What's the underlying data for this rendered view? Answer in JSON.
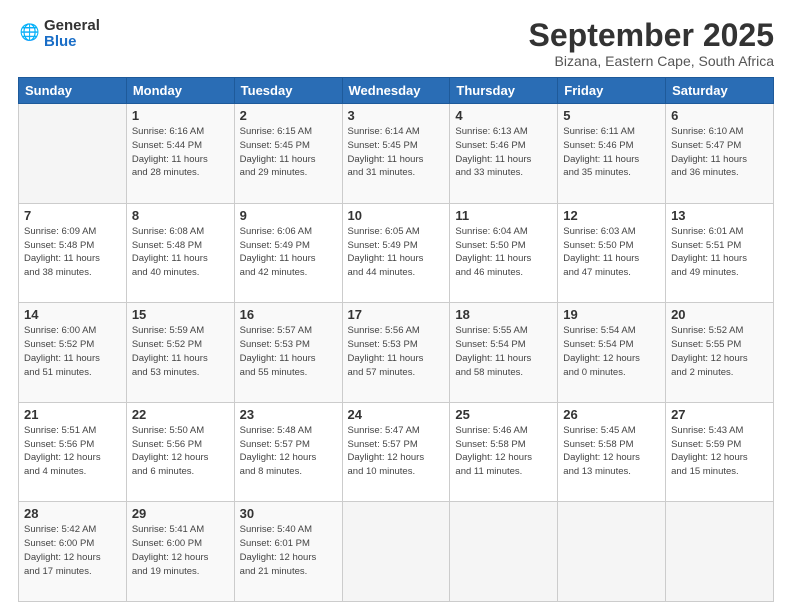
{
  "header": {
    "logo_general": "General",
    "logo_blue": "Blue",
    "title": "September 2025",
    "subtitle": "Bizana, Eastern Cape, South Africa"
  },
  "weekdays": [
    "Sunday",
    "Monday",
    "Tuesday",
    "Wednesday",
    "Thursday",
    "Friday",
    "Saturday"
  ],
  "weeks": [
    [
      {
        "day": "",
        "info": ""
      },
      {
        "day": "1",
        "info": "Sunrise: 6:16 AM\nSunset: 5:44 PM\nDaylight: 11 hours\nand 28 minutes."
      },
      {
        "day": "2",
        "info": "Sunrise: 6:15 AM\nSunset: 5:45 PM\nDaylight: 11 hours\nand 29 minutes."
      },
      {
        "day": "3",
        "info": "Sunrise: 6:14 AM\nSunset: 5:45 PM\nDaylight: 11 hours\nand 31 minutes."
      },
      {
        "day": "4",
        "info": "Sunrise: 6:13 AM\nSunset: 5:46 PM\nDaylight: 11 hours\nand 33 minutes."
      },
      {
        "day": "5",
        "info": "Sunrise: 6:11 AM\nSunset: 5:46 PM\nDaylight: 11 hours\nand 35 minutes."
      },
      {
        "day": "6",
        "info": "Sunrise: 6:10 AM\nSunset: 5:47 PM\nDaylight: 11 hours\nand 36 minutes."
      }
    ],
    [
      {
        "day": "7",
        "info": "Sunrise: 6:09 AM\nSunset: 5:48 PM\nDaylight: 11 hours\nand 38 minutes."
      },
      {
        "day": "8",
        "info": "Sunrise: 6:08 AM\nSunset: 5:48 PM\nDaylight: 11 hours\nand 40 minutes."
      },
      {
        "day": "9",
        "info": "Sunrise: 6:06 AM\nSunset: 5:49 PM\nDaylight: 11 hours\nand 42 minutes."
      },
      {
        "day": "10",
        "info": "Sunrise: 6:05 AM\nSunset: 5:49 PM\nDaylight: 11 hours\nand 44 minutes."
      },
      {
        "day": "11",
        "info": "Sunrise: 6:04 AM\nSunset: 5:50 PM\nDaylight: 11 hours\nand 46 minutes."
      },
      {
        "day": "12",
        "info": "Sunrise: 6:03 AM\nSunset: 5:50 PM\nDaylight: 11 hours\nand 47 minutes."
      },
      {
        "day": "13",
        "info": "Sunrise: 6:01 AM\nSunset: 5:51 PM\nDaylight: 11 hours\nand 49 minutes."
      }
    ],
    [
      {
        "day": "14",
        "info": "Sunrise: 6:00 AM\nSunset: 5:52 PM\nDaylight: 11 hours\nand 51 minutes."
      },
      {
        "day": "15",
        "info": "Sunrise: 5:59 AM\nSunset: 5:52 PM\nDaylight: 11 hours\nand 53 minutes."
      },
      {
        "day": "16",
        "info": "Sunrise: 5:57 AM\nSunset: 5:53 PM\nDaylight: 11 hours\nand 55 minutes."
      },
      {
        "day": "17",
        "info": "Sunrise: 5:56 AM\nSunset: 5:53 PM\nDaylight: 11 hours\nand 57 minutes."
      },
      {
        "day": "18",
        "info": "Sunrise: 5:55 AM\nSunset: 5:54 PM\nDaylight: 11 hours\nand 58 minutes."
      },
      {
        "day": "19",
        "info": "Sunrise: 5:54 AM\nSunset: 5:54 PM\nDaylight: 12 hours\nand 0 minutes."
      },
      {
        "day": "20",
        "info": "Sunrise: 5:52 AM\nSunset: 5:55 PM\nDaylight: 12 hours\nand 2 minutes."
      }
    ],
    [
      {
        "day": "21",
        "info": "Sunrise: 5:51 AM\nSunset: 5:56 PM\nDaylight: 12 hours\nand 4 minutes."
      },
      {
        "day": "22",
        "info": "Sunrise: 5:50 AM\nSunset: 5:56 PM\nDaylight: 12 hours\nand 6 minutes."
      },
      {
        "day": "23",
        "info": "Sunrise: 5:48 AM\nSunset: 5:57 PM\nDaylight: 12 hours\nand 8 minutes."
      },
      {
        "day": "24",
        "info": "Sunrise: 5:47 AM\nSunset: 5:57 PM\nDaylight: 12 hours\nand 10 minutes."
      },
      {
        "day": "25",
        "info": "Sunrise: 5:46 AM\nSunset: 5:58 PM\nDaylight: 12 hours\nand 11 minutes."
      },
      {
        "day": "26",
        "info": "Sunrise: 5:45 AM\nSunset: 5:58 PM\nDaylight: 12 hours\nand 13 minutes."
      },
      {
        "day": "27",
        "info": "Sunrise: 5:43 AM\nSunset: 5:59 PM\nDaylight: 12 hours\nand 15 minutes."
      }
    ],
    [
      {
        "day": "28",
        "info": "Sunrise: 5:42 AM\nSunset: 6:00 PM\nDaylight: 12 hours\nand 17 minutes."
      },
      {
        "day": "29",
        "info": "Sunrise: 5:41 AM\nSunset: 6:00 PM\nDaylight: 12 hours\nand 19 minutes."
      },
      {
        "day": "30",
        "info": "Sunrise: 5:40 AM\nSunset: 6:01 PM\nDaylight: 12 hours\nand 21 minutes."
      },
      {
        "day": "",
        "info": ""
      },
      {
        "day": "",
        "info": ""
      },
      {
        "day": "",
        "info": ""
      },
      {
        "day": "",
        "info": ""
      }
    ]
  ]
}
